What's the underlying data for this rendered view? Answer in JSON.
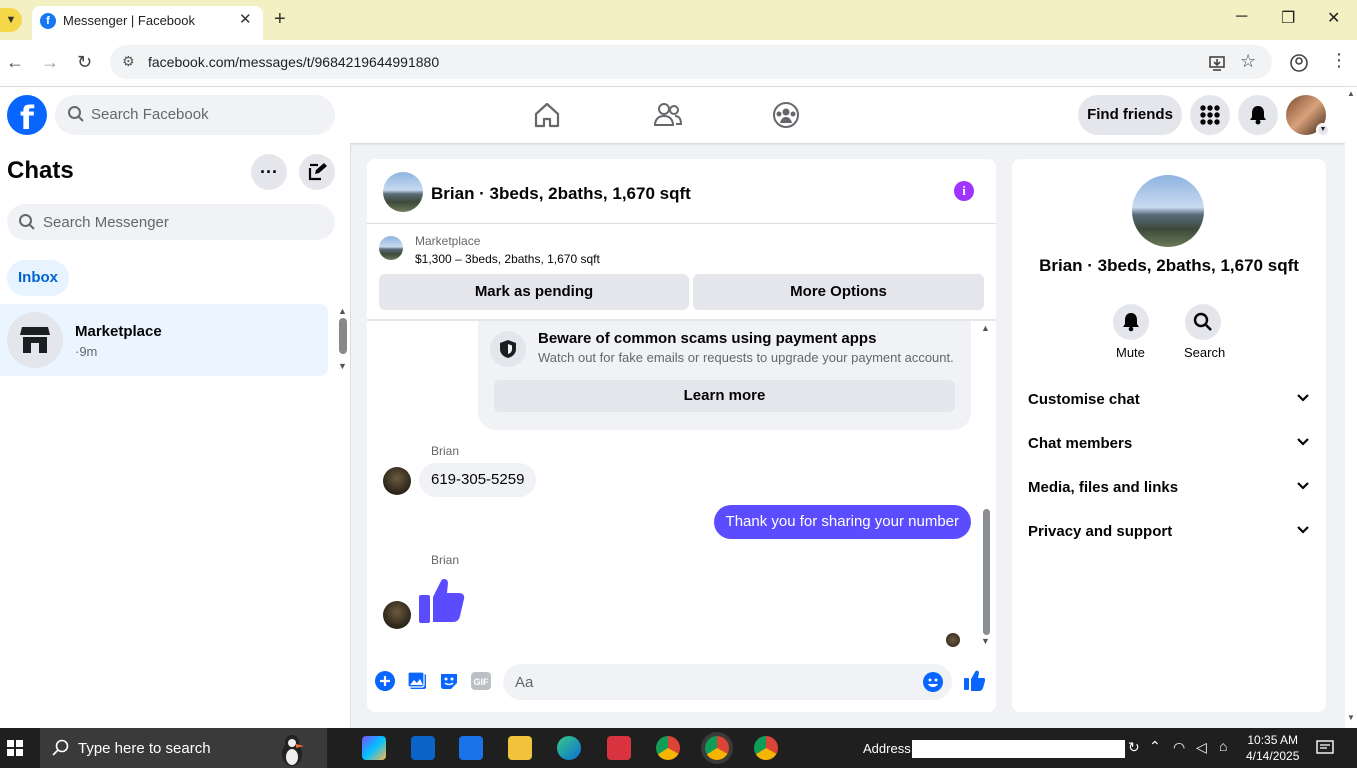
{
  "browser": {
    "tab_title": "Messenger | Facebook",
    "url": "facebook.com/messages/t/9684219644991880"
  },
  "fb_header": {
    "logo": "f",
    "search_placeholder": "Search Facebook",
    "find_friends": "Find friends"
  },
  "chats": {
    "title": "Chats",
    "search_placeholder": "Search Messenger",
    "inbox_label": "Inbox",
    "items": [
      {
        "name": "Marketplace",
        "time": "·9m"
      }
    ]
  },
  "conversation": {
    "title": "Brian · 3beds, 2baths, 1,670 sqft",
    "marketplace_label": "Marketplace",
    "listing": "$1,300 – 3beds, 2baths, 1,670 sqft",
    "mark_pending": "Mark as pending",
    "more_options": "More Options",
    "scam_title": "Beware of common scams using payment apps",
    "scam_body": "Watch out for fake emails or requests to upgrade your payment account.",
    "learn_more": "Learn more",
    "messages": [
      {
        "sender": "Brian",
        "text": "619-305-5259"
      },
      {
        "sender": "me",
        "text": "Thank you for sharing your number"
      },
      {
        "sender": "Brian",
        "text": ""
      }
    ],
    "composer_placeholder": "Aa"
  },
  "details": {
    "name": "Brian · 3beds, 2baths, 1,670 sqft",
    "mute": "Mute",
    "search": "Search",
    "sections": [
      "Customise chat",
      "Chat members",
      "Media, files and links",
      "Privacy and support"
    ]
  },
  "taskbar": {
    "search_placeholder": "Type here to search",
    "address_label": "Address",
    "time": "10:35 AM",
    "date": "4/14/2025"
  },
  "colors": {
    "fb_blue": "#0866ff",
    "messenger_purple": "#5b4cff",
    "info_purple": "#a033ff"
  }
}
